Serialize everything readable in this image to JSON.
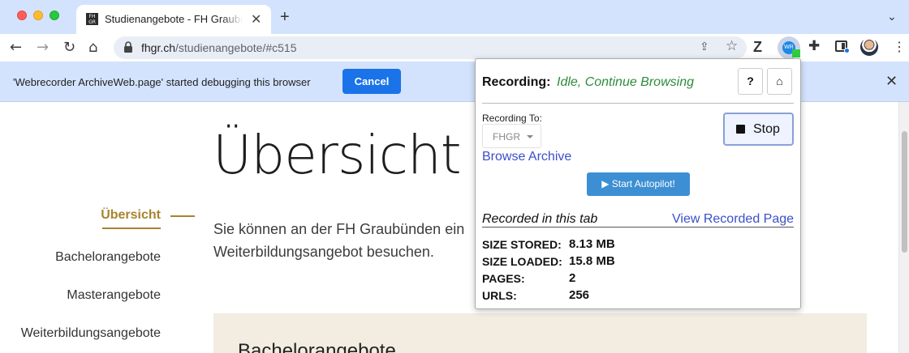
{
  "browser": {
    "tab": {
      "favicon_text": "FH GR",
      "title": "Studienangebote - FH Graubünden",
      "close": "✕"
    },
    "new_tab": "+",
    "tab_search": "⌄",
    "url_host": "fhgr.ch",
    "url_path": "/studienangebote/#c515",
    "icons": {
      "back": "←",
      "forward": "→",
      "reload": "↻",
      "home": "⌂",
      "share": "⇪",
      "star": "☆",
      "z": "Z",
      "puzzle": "✚",
      "menu": "⋮",
      "wr_badge": "WR"
    }
  },
  "infobar": {
    "message": "'Webrecorder ArchiveWeb.page' started debugging this browser",
    "cancel_label": "Cancel",
    "close": "✕"
  },
  "page": {
    "heading": "Übersicht",
    "sidebar": [
      {
        "label": "Übersicht",
        "active": true
      },
      {
        "label": "Bachelorangebote"
      },
      {
        "label": "Masterangebote"
      },
      {
        "label": "Weiterbildungsangebote"
      }
    ],
    "intro": "Sie können an der FH Graubünden ein Weiterbildungsangebot besuchen.",
    "section_title": "Bachelorangebote"
  },
  "popup": {
    "recording_label": "Recording:",
    "status": "Idle, Continue Browsing",
    "help_label": "?",
    "home_icon": "⌂",
    "recording_to_label": "Recording To:",
    "collection": "FHGR",
    "browse_archive": "Browse Archive",
    "stop_label": "Stop",
    "autopilot_label": "▶ Start Autopilot!",
    "recorded_in_tab": "Recorded in this tab",
    "view_recorded_page": "View Recorded Page",
    "stats": [
      {
        "key": "SIZE STORED:",
        "value": "8.13 MB"
      },
      {
        "key": "SIZE LOADED:",
        "value": "15.8 MB"
      },
      {
        "key": "PAGES:",
        "value": "2"
      },
      {
        "key": "URLS:",
        "value": "256"
      }
    ]
  },
  "colors": {
    "tabstrip": "#d3e3fd",
    "accent_gold": "#a8832e",
    "status_green": "#2e8b3a",
    "link_blue": "#3b4fc9",
    "cancel_button": "#1a73e8"
  }
}
